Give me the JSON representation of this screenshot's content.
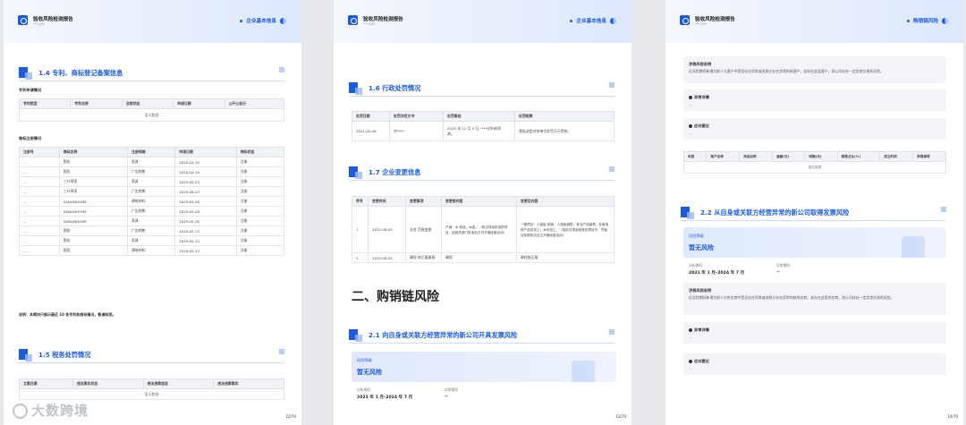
{
  "report_title": "验收风险检测报告",
  "report_sub": "***公司",
  "pages": [
    {
      "header_section": "企业基本信息",
      "page_no": "12/70",
      "s14": "1.4 专利、商标登记备案信息",
      "patent_label": "专利申请情况",
      "patent_headers": [
        "专利类型",
        "专利名称",
        "当前状态",
        "申请日期",
        "公开公告日"
      ],
      "patent_empty": "暂无数据",
      "tm_label": "商标注册情况",
      "tm_headers": [
        "注册号",
        "商标名称",
        "注册领域",
        "申请日期",
        "商标状态"
      ],
      "tm_rows": [
        [
          "--",
          "图形",
          "家具",
          "2020-10-19",
          "注册"
        ],
        [
          "--",
          "图形",
          "广告销售",
          "2020-10-19",
          "注册"
        ],
        [
          "--",
          "三叶草家",
          "家具",
          "2019-08-23",
          "注册"
        ],
        [
          "--",
          "三叶草家",
          "广告销售",
          "2019-08-23",
          "注册"
        ],
        [
          "--",
          "SANLINHOME",
          "建筑材料",
          "2019-05-28",
          "注册"
        ],
        [
          "--",
          "SANLINHOME",
          "广告销售",
          "2019-05-28",
          "注册"
        ],
        [
          "--",
          "SANLINHOME",
          "家具",
          "2019-05-28",
          "注册"
        ],
        [
          "--",
          "图形",
          "广告销售",
          "2019-05-13",
          "注册"
        ],
        [
          "--",
          "图形",
          "家具",
          "2019-05-13",
          "注册"
        ],
        [
          "--",
          "图形",
          "建筑材料",
          "2019-05-13",
          "注册"
        ]
      ],
      "note": "说明：本模块只展示最近 10 条专利和商标情况，敬请知悉。",
      "s15": "1.5 税务处罚情况",
      "tax_headers": [
        "立案日期",
        "违法事实状态",
        "违法违章信息",
        "违法违章事实"
      ],
      "tax_empty": "暂无数据"
    },
    {
      "header_section": "企业基本信息",
      "page_no": "13/70",
      "s16": "1.6 行政处罚情况",
      "pen_headers": [
        "处罚日期",
        "处罚决定文书",
        "处罚事由",
        "处罚结果"
      ],
      "pen_row": [
        "2021-02-26",
        "京****",
        "2020 年 12 月 5 日,“***对外修改",
        "我局决定对你单位处罚万元罚款。"
      ],
      "pen_row2": "改。",
      "s17": "1.7 企业变更信息",
      "chg_headers": [
        "序号",
        "变更时间",
        "变更事项",
        "变更前内容",
        "变更后内容"
      ],
      "chg_row1": [
        "1",
        "2022-08-03",
        "业务 范围变更",
        "产销：木 制品、木皮。（依法须经批准的项目，经相关部门批准后方可开展经营活动）",
        "一般项目：人造板 制造；人造板销售；林业产品销售；非食用林产品初加工；木材加工。（除依法须经批准的项目外，凭营业执照依法自主开展经营活动）"
      ],
      "chg_row2": [
        "2",
        "2022-08-03",
        "章程 修正案备案",
        "章程",
        "章程修正案"
      ],
      "chapter": "二、购销链风险",
      "s21": "2.1 向自身或关联方经营异常的新公司开具发票风险",
      "risk_label": "风险等级",
      "risk_value": "暂无风险",
      "period_label": "分析期间",
      "period_value": "2021 年 1 月–2024 年 7 月",
      "abn_label": "异常期间",
      "abn_value": "--"
    },
    {
      "header_section": "购销链风险",
      "page_no": "14/70",
      "c1_title": "涉税风险说明",
      "c1_text": "近风险期间新增为前十大客户中是否存在异常或关联方存在异常的新客户，若存在此类客户，则公司存在一定异常交易的风险。",
      "c2_title": "异常详情",
      "c2_text": "--",
      "c3_title": "应对建议",
      "c3_text": "--",
      "t_headers": [
        "年度",
        "客户名称",
        "商品名称",
        "金额(元)",
        "税额(元)",
        "销售占比(%)",
        "成立时间",
        "异常事项"
      ],
      "t_empty": "暂无数据",
      "s22": "2.2 从自身或关联方经营异常的新公司取得发票风险",
      "risk_label": "风险等级",
      "risk_value": "暂无风险",
      "period_label": "分析期间",
      "period_value": "2021 年 1 月–2024 年 7 月",
      "abn_label": "异常期间",
      "abn_value": "--",
      "c4_title": "涉税风险说明",
      "c4_text": "近风险期间新增为前十大供应商中是否存在异常或关联方存在异常的新供应商，若存在此类供应商，则公司存在一定异常交易的风险。",
      "c5_title": "异常详情",
      "c5_text": "--",
      "c6_title": "应对建议",
      "c6_text": "--"
    }
  ],
  "watermark": "大数跨境"
}
